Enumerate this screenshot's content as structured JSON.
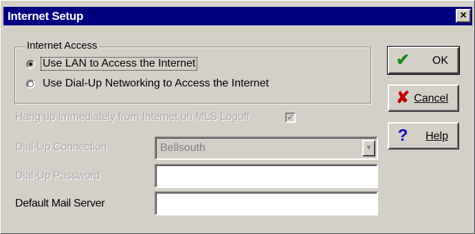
{
  "window": {
    "title": "Internet Setup",
    "close_glyph": "×"
  },
  "group": {
    "legend": "Internet Access",
    "options": [
      {
        "label": "Use LAN to Access the Internet",
        "checked": true
      },
      {
        "label": "Use Dial-Up Networking to Access the Internet",
        "checked": false
      }
    ]
  },
  "hangup": {
    "label": "Hang up Immediately from Internet on MLS Logoff",
    "checked": true,
    "check_glyph": "✓"
  },
  "dialup_connection": {
    "label": "Dial-Up Connection",
    "value": "Bellsouth",
    "arrow_glyph": "▼"
  },
  "dialup_password": {
    "label": "Dial-Up Password",
    "value": ""
  },
  "mail_server": {
    "label": "Default Mail Server",
    "value": ""
  },
  "buttons": {
    "ok": {
      "label": "OK",
      "icon": "checkmark-icon",
      "icon_glyph": "✔",
      "icon_color": "#1a8a1a"
    },
    "cancel": {
      "label": "Cancel",
      "icon": "x-icon",
      "icon_glyph": "✘",
      "icon_color": "#c00000"
    },
    "help": {
      "label": "Help",
      "icon": "question-icon",
      "icon_glyph": "?",
      "icon_color": "#0000c0"
    }
  }
}
